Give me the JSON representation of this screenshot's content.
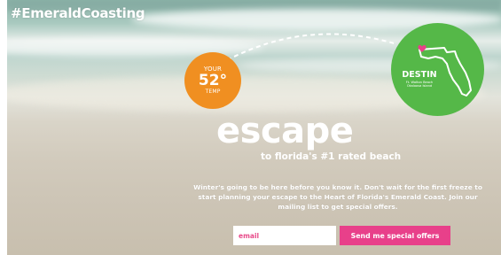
{
  "brand": {
    "hashtag": "#EmeraldCoasting"
  },
  "temperature": {
    "top_label": "YOUR",
    "value": "52°",
    "bottom_label": "TEMP"
  },
  "destination": {
    "name": "DESTIN",
    "subtitle": "Ft. Walton Beach\nOkaloosa Island"
  },
  "hero": {
    "headline": "escape",
    "tagline": "to florida's #1 rated beach"
  },
  "body": {
    "text": "Winter's going to be here before you know it. Don't wait for the first freeze to start planning your escape to the Heart of Florida's Emerald Coast. Join our mailing list to get special offers."
  },
  "signup": {
    "email_placeholder": "email",
    "button_label": "Send me special offers"
  },
  "colors": {
    "orange": "#f08f21",
    "green": "#55b848",
    "pink": "#e8408a"
  },
  "icons": {
    "state": "florida-map-icon",
    "location": "heart-pin-icon"
  }
}
